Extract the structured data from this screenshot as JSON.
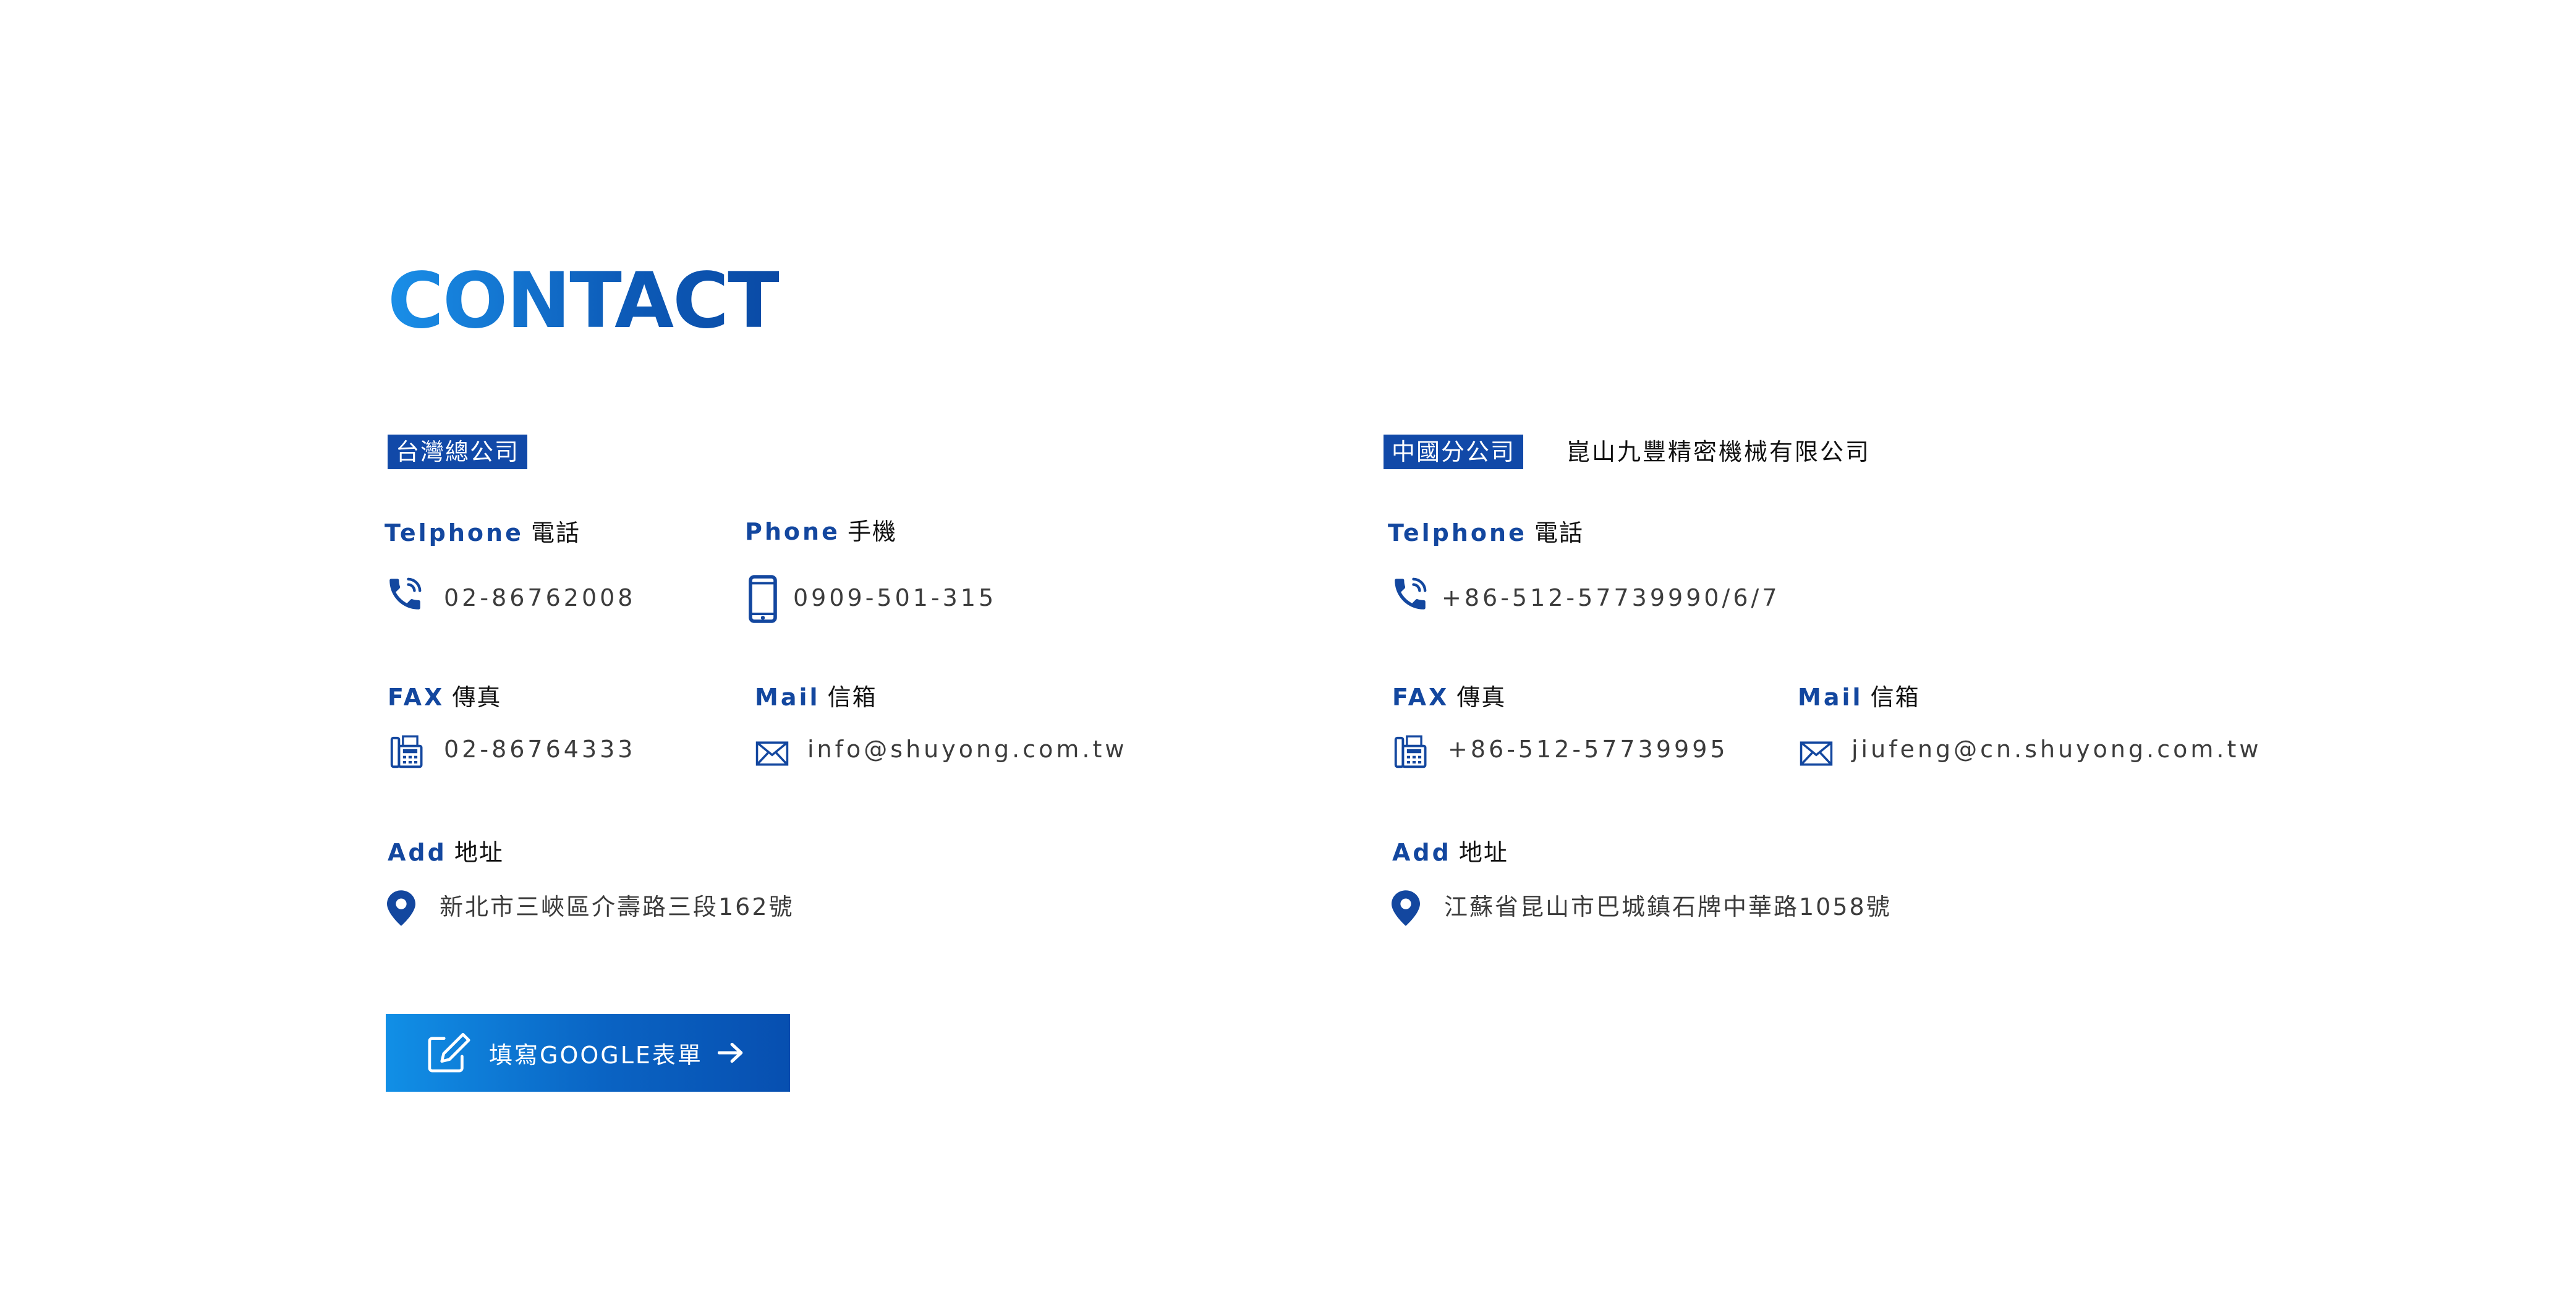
{
  "title": "CONTACT",
  "taiwan": {
    "badge": "台灣總公司",
    "tel": {
      "label_en": "Telphone",
      "label_zh": "電話",
      "value": "02-86762008"
    },
    "phone": {
      "label_en": "Phone",
      "label_zh": "手機",
      "value": "0909-501-315"
    },
    "fax": {
      "label_en": "FAX",
      "label_zh": "傳真",
      "value": "02-86764333"
    },
    "mail": {
      "label_en": "Mail",
      "label_zh": "信箱",
      "value": "info@shuyong.com.tw"
    },
    "add": {
      "label_en": "Add",
      "label_zh": "地址",
      "value": "新北市三峽區介壽路三段162號"
    }
  },
  "china": {
    "badge": "中國分公司",
    "company": "崑山九豐精密機械有限公司",
    "tel": {
      "label_en": "Telphone",
      "label_zh": "電話",
      "value": "+86-512-57739990/6/7"
    },
    "fax": {
      "label_en": "FAX",
      "label_zh": "傳真",
      "value": "+86-512-57739995"
    },
    "mail": {
      "label_en": "Mail",
      "label_zh": "信箱",
      "value": "jiufeng@cn.shuyong.com.tw"
    },
    "add": {
      "label_en": "Add",
      "label_zh": "地址",
      "value": "江蘇省昆山市巴城鎮石牌中華路1058號"
    }
  },
  "cta": {
    "label": "填寫GOOGLE表單"
  },
  "colors": {
    "accent": "#13479f",
    "badge_bg": "#1149a8",
    "gradient_start": "#118fe6",
    "gradient_end": "#074fb0"
  },
  "icons": [
    "phone-call-icon",
    "mobile-phone-icon",
    "fax-icon",
    "mail-icon",
    "map-pin-icon",
    "edit-icon",
    "arrow-right-icon"
  ]
}
